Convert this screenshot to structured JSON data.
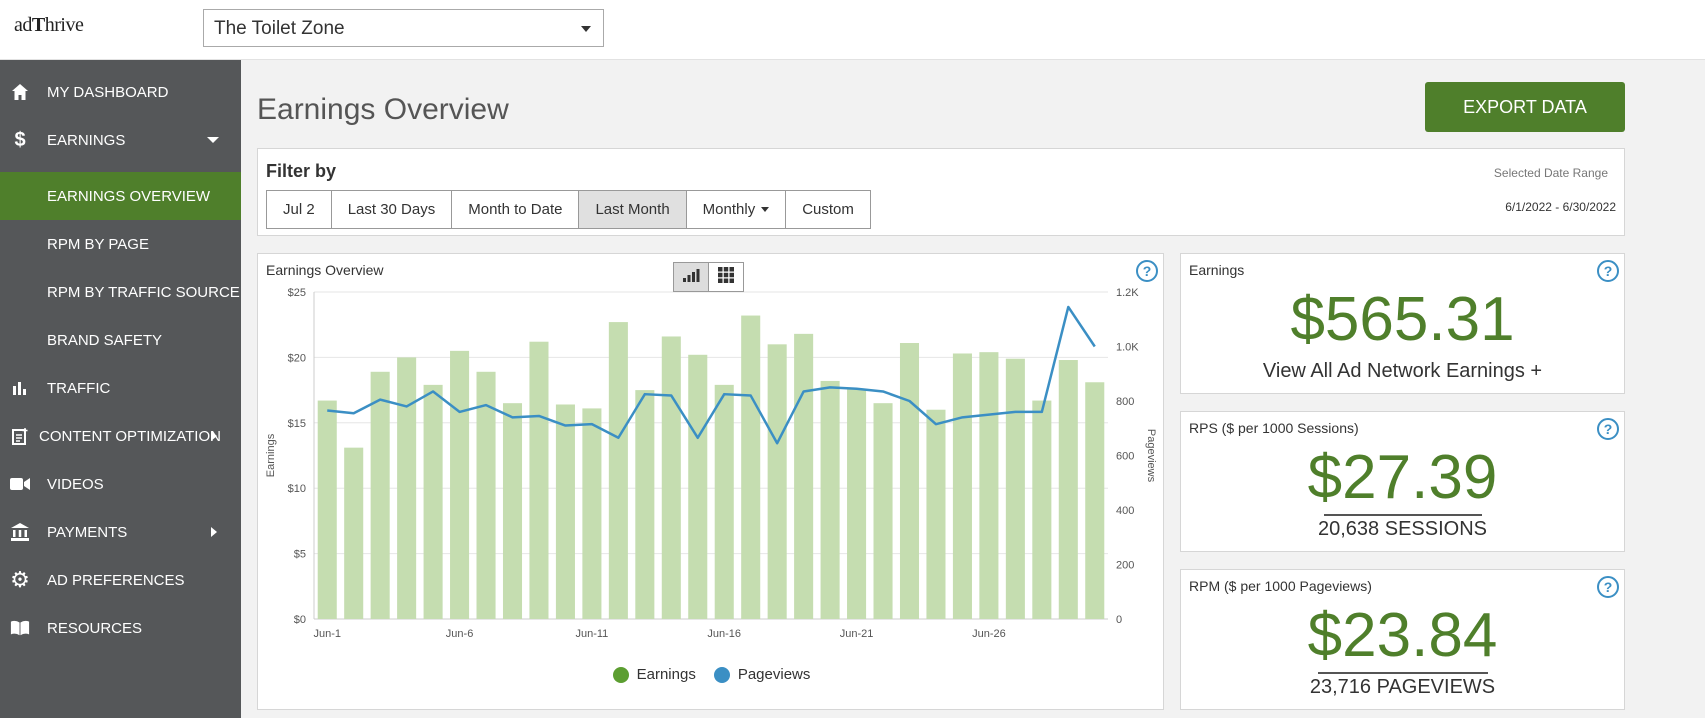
{
  "app": {
    "logo_prefix": "ad",
    "logo_suffix": "hrive",
    "logo_t": "T"
  },
  "site_select": {
    "value": "The Toilet Zone"
  },
  "sidebar": {
    "items": [
      {
        "label": "MY DASHBOARD",
        "icon": "home-icon"
      },
      {
        "label": "EARNINGS",
        "icon": "dollar-icon"
      },
      {
        "label": "EARNINGS OVERVIEW"
      },
      {
        "label": "RPM BY PAGE"
      },
      {
        "label": "RPM BY TRAFFIC SOURCE"
      },
      {
        "label": "BRAND SAFETY"
      },
      {
        "label": "TRAFFIC",
        "icon": "bar-chart-icon"
      },
      {
        "label": "CONTENT OPTIMIZATION",
        "icon": "document-icon"
      },
      {
        "label": "VIDEOS",
        "icon": "video-icon"
      },
      {
        "label": "PAYMENTS",
        "icon": "bank-icon"
      },
      {
        "label": "AD PREFERENCES",
        "icon": "gear-icon"
      },
      {
        "label": "RESOURCES",
        "icon": "book-icon"
      }
    ]
  },
  "main": {
    "title": "Earnings Overview",
    "export_label": "EXPORT DATA"
  },
  "filter": {
    "title": "Filter by",
    "buttons": [
      "Jul 2",
      "Last 30 Days",
      "Month to Date",
      "Last Month",
      "Monthly",
      "Custom"
    ],
    "active": "Last Month",
    "date_range_label": "Selected Date Range",
    "date_range_value": "6/1/2022 - 6/30/2022"
  },
  "chart_panel": {
    "title": "Earnings Overview",
    "help": "?"
  },
  "cards": {
    "earnings": {
      "title": "Earnings",
      "value": "$565.31",
      "link": "View All Ad Network Earnings +"
    },
    "rps": {
      "title": "RPS ($ per 1000 Sessions)",
      "value": "$27.39",
      "sub": "20,638 SESSIONS"
    },
    "rpm": {
      "title": "RPM ($ per 1000 Pageviews)",
      "value": "$23.84",
      "sub": "23,716 PAGEVIEWS"
    }
  },
  "colors": {
    "green": "#4f7f2b",
    "bar": "#c5ddb0",
    "line": "#3b8fc4",
    "sidebar": "#555759"
  },
  "chart_data": {
    "type": "bar",
    "title": "",
    "ylabel": "Earnings",
    "y2label": "Pageviews",
    "ylim": [
      0,
      25
    ],
    "y2lim": [
      0,
      1200
    ],
    "y_ticks": [
      "$0",
      "$5",
      "$10",
      "$15",
      "$20",
      "$25"
    ],
    "y2_ticks": [
      "0",
      "200",
      "400",
      "600",
      "800",
      "1.0K",
      "1.2K"
    ],
    "x_tick_labels": [
      "Jun-1",
      "Jun-6",
      "Jun-11",
      "Jun-16",
      "Jun-21",
      "Jun-26"
    ],
    "x_tick_index": [
      0,
      5,
      10,
      15,
      20,
      25
    ],
    "categories": [
      "Jun-1",
      "Jun-2",
      "Jun-3",
      "Jun-4",
      "Jun-5",
      "Jun-6",
      "Jun-7",
      "Jun-8",
      "Jun-9",
      "Jun-10",
      "Jun-11",
      "Jun-12",
      "Jun-13",
      "Jun-14",
      "Jun-15",
      "Jun-16",
      "Jun-17",
      "Jun-18",
      "Jun-19",
      "Jun-20",
      "Jun-21",
      "Jun-22",
      "Jun-23",
      "Jun-24",
      "Jun-25",
      "Jun-26",
      "Jun-27",
      "Jun-28",
      "Jun-29",
      "Jun-30"
    ],
    "series": [
      {
        "name": "Earnings",
        "type": "bar",
        "color": "#c5ddb0",
        "legend_color": "#5c9e31",
        "values": [
          16.7,
          13.1,
          18.9,
          20.0,
          17.9,
          20.5,
          18.9,
          16.5,
          21.2,
          16.4,
          16.1,
          22.7,
          17.5,
          21.6,
          20.2,
          17.9,
          23.2,
          21.0,
          21.8,
          18.2,
          17.6,
          16.5,
          21.1,
          16.0,
          20.3,
          20.4,
          19.9,
          16.7,
          19.8,
          18.1
        ]
      },
      {
        "name": "Pageviews",
        "type": "line",
        "color": "#3b8fc4",
        "legend_color": "#3b8fc4",
        "values": [
          765,
          755,
          805,
          780,
          835,
          760,
          785,
          740,
          745,
          710,
          715,
          665,
          825,
          820,
          665,
          825,
          820,
          645,
          835,
          850,
          845,
          835,
          800,
          715,
          740,
          750,
          760,
          760,
          1145,
          1000
        ]
      }
    ],
    "legend": [
      "Earnings",
      "Pageviews"
    ],
    "legend_position": "bottom"
  }
}
